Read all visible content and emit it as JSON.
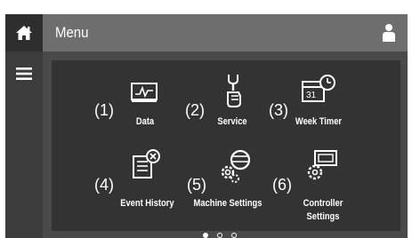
{
  "header": {
    "title": "Menu"
  },
  "tiles": [
    {
      "number": "(1)",
      "label": "Data",
      "icon": "chart-monitor-icon"
    },
    {
      "number": "(2)",
      "label": "Service",
      "icon": "wrench-hand-icon"
    },
    {
      "number": "(3)",
      "label": "Week Timer",
      "icon": "calendar-timer-icon"
    },
    {
      "number": "(4)",
      "label": "Event History",
      "icon": "document-error-icon"
    },
    {
      "number": "(5)",
      "label": "Machine Settings",
      "icon": "gears-icon"
    },
    {
      "number": "(6)",
      "label": "Controller",
      "label2": "Settings",
      "icon": "controller-gear-icon"
    }
  ],
  "pagination": {
    "pages": 3,
    "current": 1
  },
  "colors": {
    "background": "#4a4a4a",
    "header": "#6e6e6e",
    "panel": "#333333",
    "text": "#ffffff"
  }
}
